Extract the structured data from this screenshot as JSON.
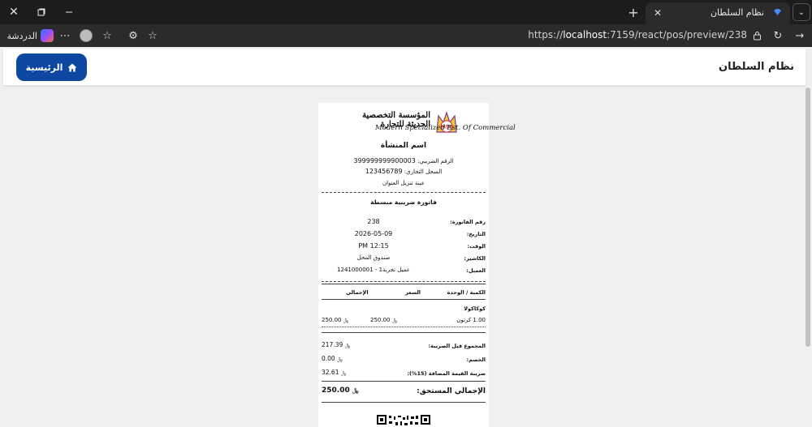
{
  "browser": {
    "tab_title": "نظام السلطان",
    "url_prefix": "https://",
    "url_host": "localhost",
    "url_rest": ":7159/react/pos/preview/238",
    "chat_label": "الدردشة",
    "icons": [
      "close-icon",
      "restore-icon",
      "minimize-icon",
      "new-tab-icon",
      "tab-menu-icon",
      "more-icon",
      "favorites-icon",
      "extensions-icon",
      "add-favorite-icon",
      "lock-icon",
      "refresh-icon",
      "forward-icon"
    ]
  },
  "app": {
    "title": "نظام السلطان",
    "home_label": "الرئيسية",
    "accent": "#0d47a1"
  },
  "receipt": {
    "logo_ar": "المؤسسة التخصصية الحديثة للتجارة",
    "logo_en": "Modern Specialized Est. Of Commercial",
    "logo_mark": "MSE",
    "org_name": "اسم المنشأة",
    "tax_line_label": "الرقم الضريبي:",
    "tax_number": "399999999900003",
    "cr_line_label": "السجل التجاري:",
    "cr_number": "123456789",
    "address": "عينة تنزيل العنوان",
    "invoice_type": "فاتورة ضريبية مبسطة",
    "fields": [
      {
        "label": "رقم الفاتورة:",
        "value": "238"
      },
      {
        "label": "التاريخ:",
        "value": "2026-05-09"
      },
      {
        "label": "الوقت:",
        "value": "12:15 PM"
      },
      {
        "label": "الكاشير:",
        "value": "صندوق المحل"
      },
      {
        "label": "العميل:",
        "value": "عميل تجربة1 - 1241000001"
      }
    ],
    "columns": {
      "qty_unit": "الكمية / الوحدة",
      "price": "السعر",
      "total": "الإجمالي"
    },
    "items": [
      {
        "name": "كوكاكولا",
        "qty_unit": "1.00 كرتون",
        "price": "250.00",
        "total": "250.00"
      }
    ],
    "currency": "﷼",
    "subtotal_label": "المجموع قبل الضريبة:",
    "subtotal": "217.39",
    "discount_label": "الخصم:",
    "discount": "0.00",
    "vat_label": "ضريبة القيمة المضافة (15%):",
    "vat": "32.61",
    "grand_label": "الإجمالي المستحق:",
    "grand_total": "250.00"
  }
}
